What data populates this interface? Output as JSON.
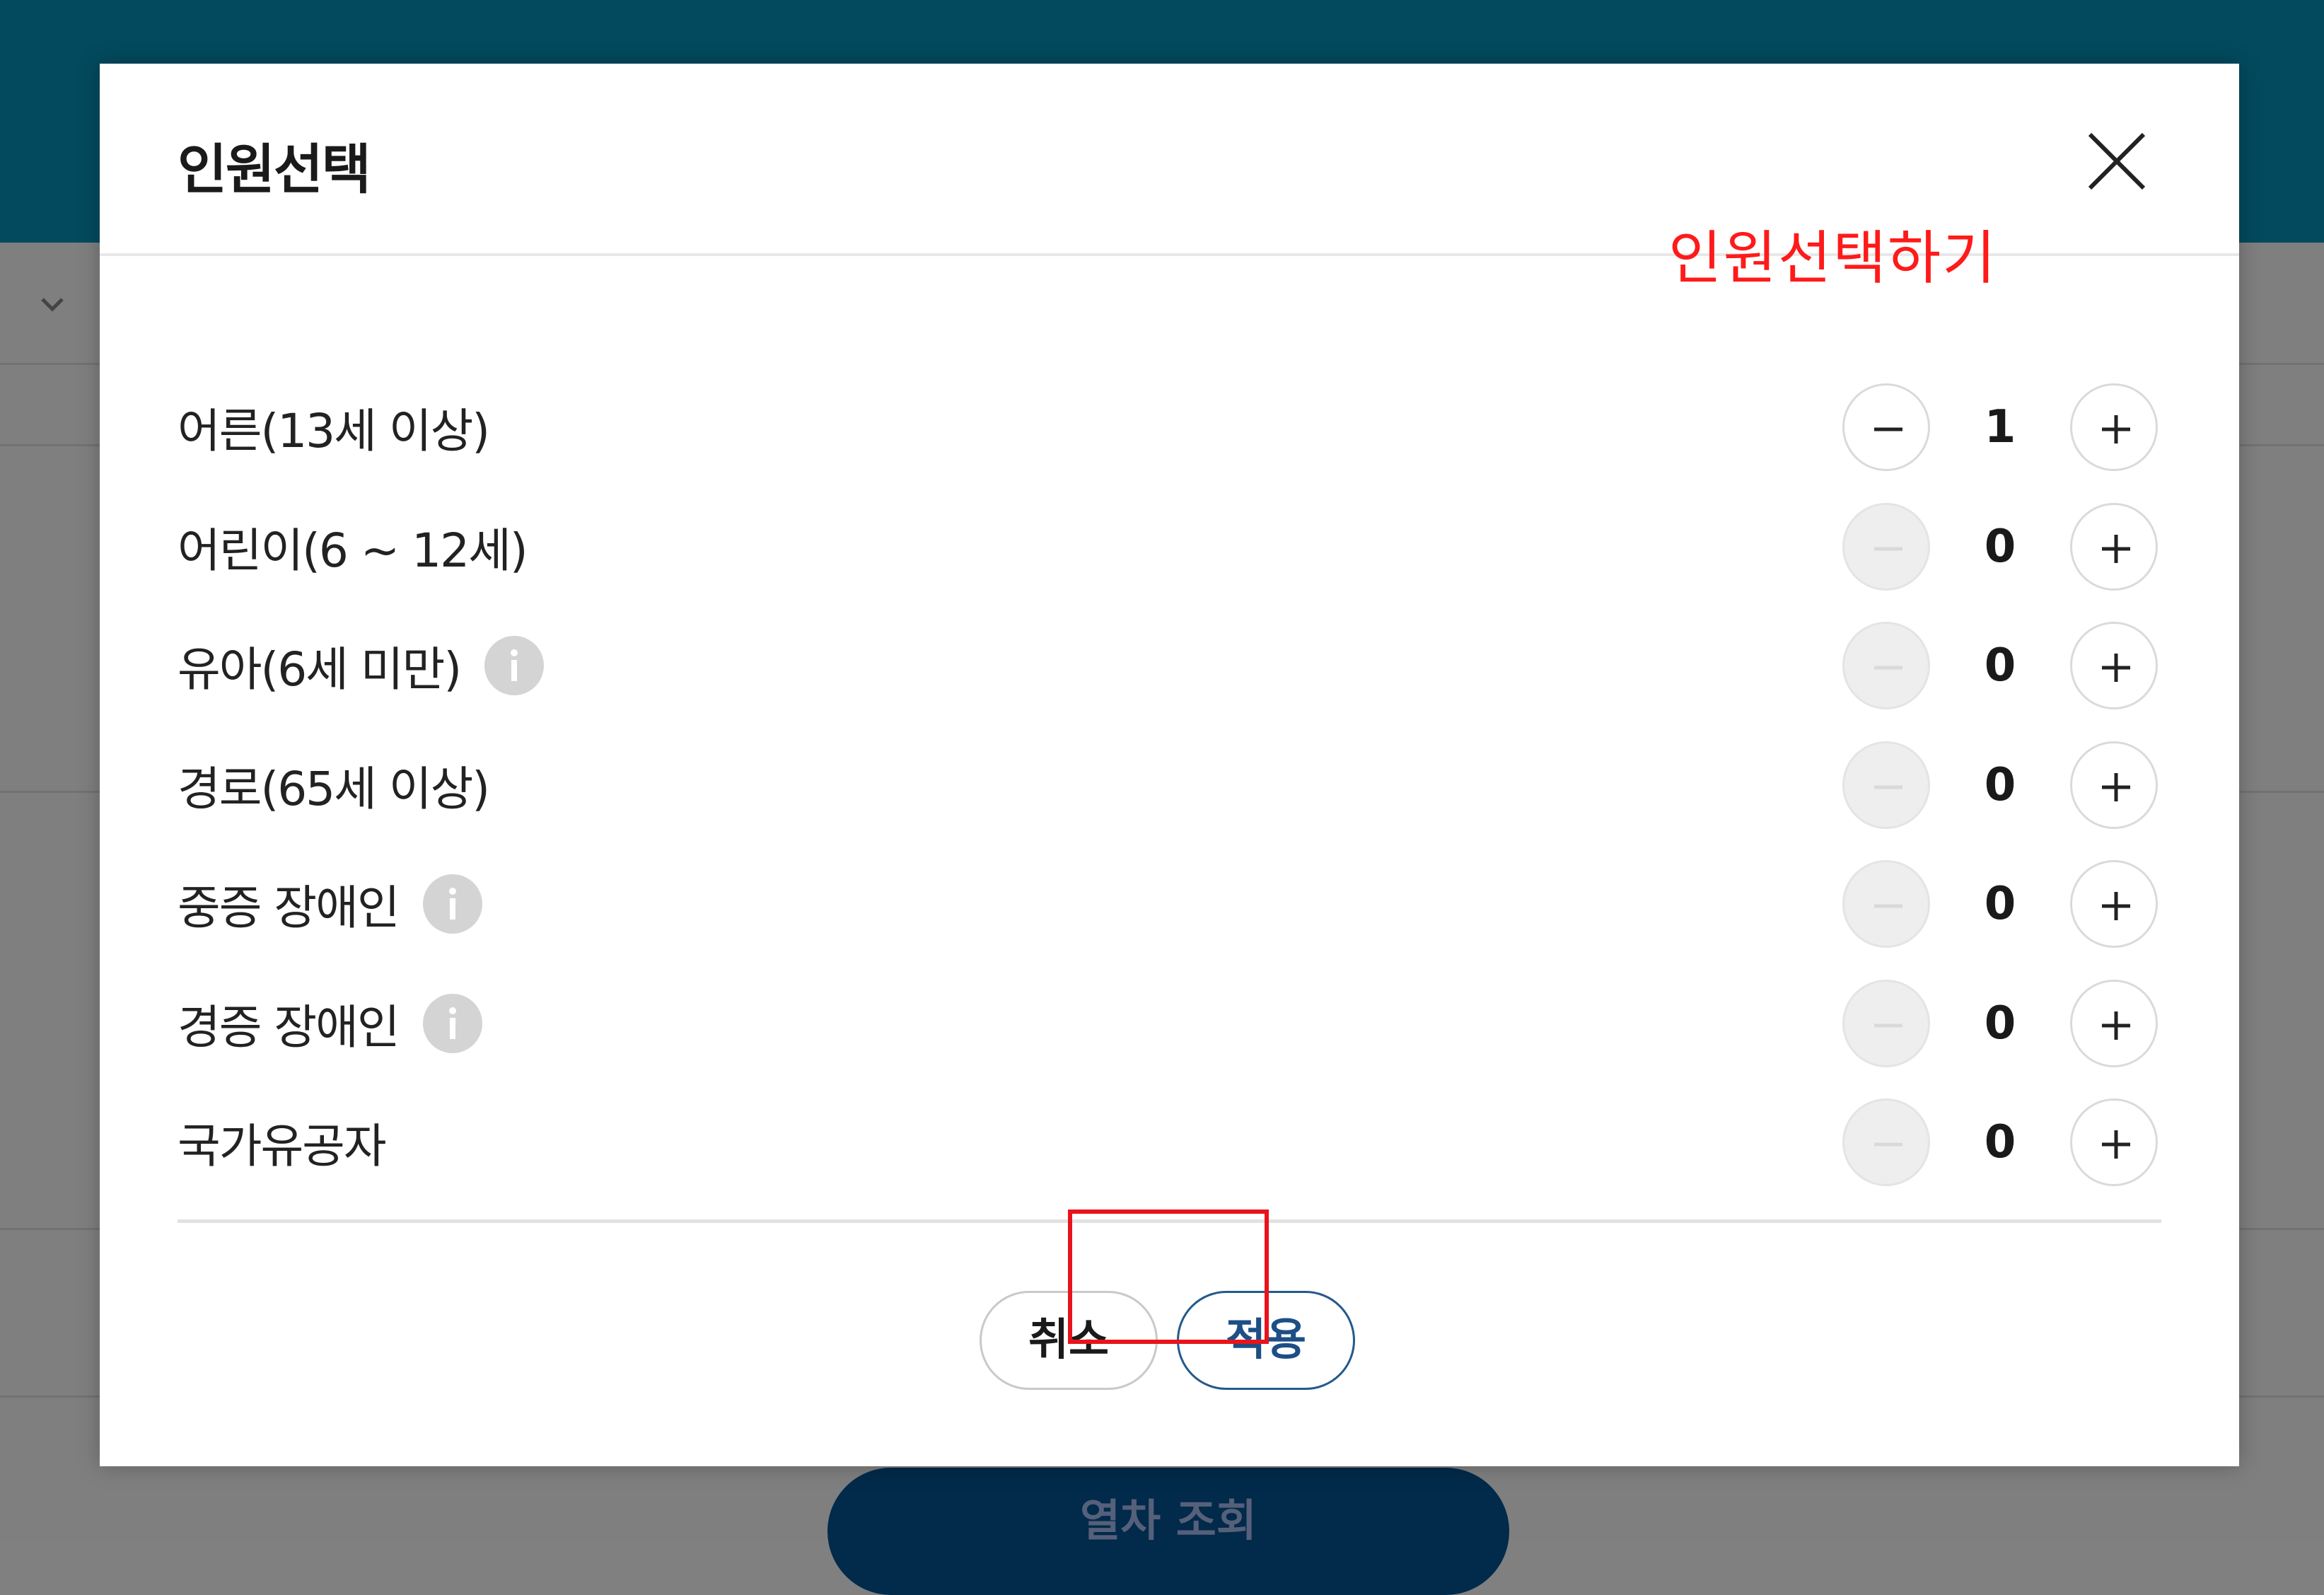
{
  "background": {
    "search_button_label": "열차 조회"
  },
  "modal": {
    "title": "인원선택",
    "annotation": "인원선택하기",
    "rows": [
      {
        "label": "어른(13세 이상)",
        "value": "1",
        "info": false,
        "minus_enabled": true
      },
      {
        "label": "어린이(6 ~ 12세)",
        "value": "0",
        "info": false,
        "minus_enabled": false
      },
      {
        "label": "유아(6세 미만)",
        "value": "0",
        "info": true,
        "minus_enabled": false
      },
      {
        "label": "경로(65세 이상)",
        "value": "0",
        "info": false,
        "minus_enabled": false
      },
      {
        "label": "중증 장애인",
        "value": "0",
        "info": true,
        "minus_enabled": false
      },
      {
        "label": "경증 장애인",
        "value": "0",
        "info": true,
        "minus_enabled": false
      },
      {
        "label": "국가유공자",
        "value": "0",
        "info": false,
        "minus_enabled": false
      }
    ],
    "cancel_label": "취소",
    "apply_label": "적용"
  },
  "icons": {
    "close": "close-icon",
    "minus": "minus-icon",
    "plus": "plus-icon",
    "info": "info-icon",
    "chevron": "chevron-down-icon"
  },
  "colors": {
    "header": "#034a5e",
    "apply_border": "#235a8c",
    "highlight": "#e8141b",
    "annotation": "#ff1a1a"
  }
}
